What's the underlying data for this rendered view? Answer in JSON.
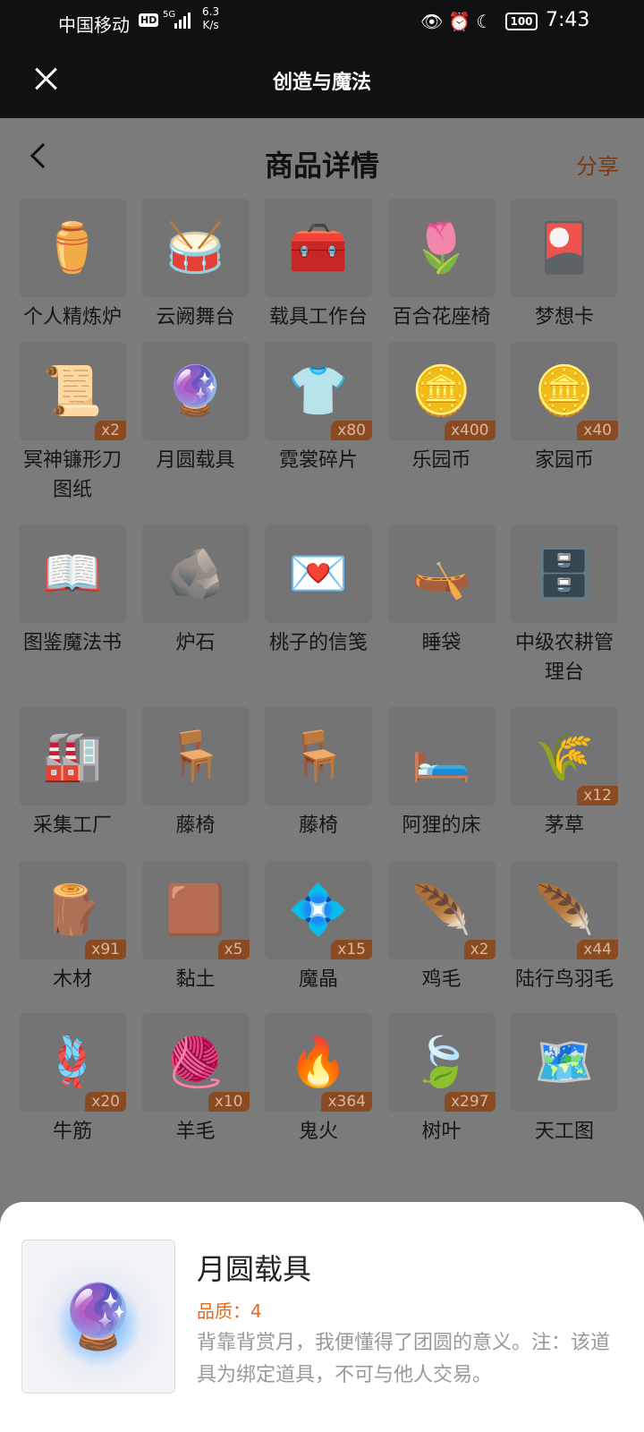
{
  "status": {
    "carrier": "中国移动",
    "hd": "HD",
    "network": "5G",
    "speed_value": "6.3",
    "speed_unit": "K/s",
    "battery": "100",
    "time": "7:43",
    "icons": [
      "eye-icon",
      "alarm-icon",
      "moon-icon"
    ]
  },
  "titlebar": {
    "title": "创造与魔法"
  },
  "header": {
    "title": "商品详情",
    "share": "分享",
    "share_color": "#e16a1c"
  },
  "items": [
    {
      "name": "个人精炼炉",
      "qty": "",
      "icon": "⚱️"
    },
    {
      "name": "云阙舞台",
      "qty": "",
      "icon": "🥁"
    },
    {
      "name": "载具工作台",
      "qty": "",
      "icon": "🧰"
    },
    {
      "name": "百合花座椅",
      "qty": "",
      "icon": "🌷"
    },
    {
      "name": "梦想卡",
      "qty": "",
      "icon": "🎴"
    },
    {
      "name": "冥神镰形刀图纸",
      "qty": "x2",
      "icon": "📜"
    },
    {
      "name": "月圆载具",
      "qty": "",
      "icon": "🔮"
    },
    {
      "name": "霓裳碎片",
      "qty": "x80",
      "icon": "👕"
    },
    {
      "name": "乐园币",
      "qty": "x400",
      "icon": "🪙"
    },
    {
      "name": "家园币",
      "qty": "x40",
      "icon": "🪙"
    },
    {
      "name": "图鉴魔法书",
      "qty": "",
      "icon": "📖"
    },
    {
      "name": "炉石",
      "qty": "",
      "icon": "🪨"
    },
    {
      "name": "桃子的信笺",
      "qty": "",
      "icon": "💌"
    },
    {
      "name": "睡袋",
      "qty": "",
      "icon": "🛶"
    },
    {
      "name": "中级农耕管理台",
      "qty": "",
      "icon": "🗄️"
    },
    {
      "name": "采集工厂",
      "qty": "",
      "icon": "🏭"
    },
    {
      "name": "藤椅",
      "qty": "",
      "icon": "🪑"
    },
    {
      "name": "藤椅",
      "qty": "",
      "icon": "🪑"
    },
    {
      "name": "阿狸的床",
      "qty": "",
      "icon": "🛏️"
    },
    {
      "name": "茅草",
      "qty": "x12",
      "icon": "🌾"
    },
    {
      "name": "木材",
      "qty": "x91",
      "icon": "🪵"
    },
    {
      "name": "黏土",
      "qty": "x5",
      "icon": "🟫"
    },
    {
      "name": "魔晶",
      "qty": "x15",
      "icon": "💠"
    },
    {
      "name": "鸡毛",
      "qty": "x2",
      "icon": "🪶"
    },
    {
      "name": "陆行鸟羽毛",
      "qty": "x44",
      "icon": "🪶"
    },
    {
      "name": "牛筋",
      "qty": "x20",
      "icon": "🪢"
    },
    {
      "name": "羊毛",
      "qty": "x10",
      "icon": "🧶"
    },
    {
      "name": "鬼火",
      "qty": "x364",
      "icon": "🔥"
    },
    {
      "name": "树叶",
      "qty": "x297",
      "icon": "🍃"
    },
    {
      "name": "天工图",
      "qty": "",
      "icon": "🗺️"
    }
  ],
  "detail": {
    "name": "月圆载具",
    "quality": "品质：4",
    "description": "背靠背赏月，我便懂得了团圆的意义。注：该道具为绑定道具，不可与他人交易。",
    "image_icon": "🔮"
  }
}
